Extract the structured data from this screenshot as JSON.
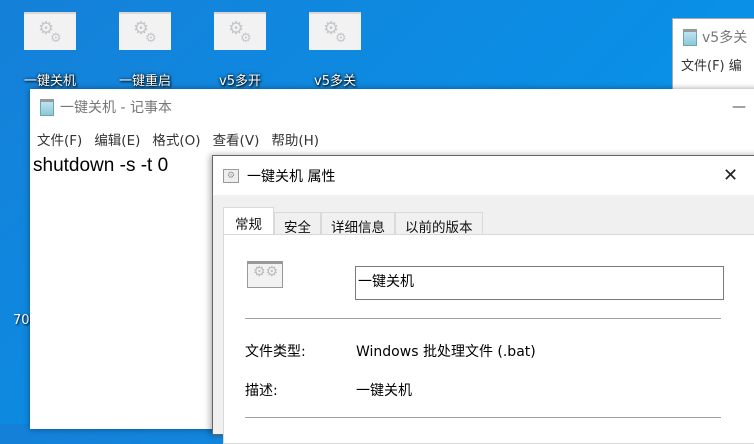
{
  "desktop": {
    "icons": [
      {
        "label": "一键关机"
      },
      {
        "label": "一键重启"
      },
      {
        "label": "v5多开"
      },
      {
        "label": "v5多关"
      }
    ],
    "partial_label": "70"
  },
  "notepad_back": {
    "title": "v5多关",
    "menu_first": "文件(F)",
    "menu_second": "编"
  },
  "notepad": {
    "title": "一键关机 - 记事本",
    "minimize": "—",
    "menu": [
      "文件(F)",
      "编辑(E)",
      "格式(O)",
      "查看(V)",
      "帮助(H)"
    ],
    "content": "shutdown -s -t 0"
  },
  "dialog": {
    "title": "一键关机 属性",
    "close": "✕",
    "tabs": [
      "常规",
      "安全",
      "详细信息",
      "以前的版本"
    ],
    "name_value": "一键关机",
    "rows": [
      {
        "label": "文件类型:",
        "value": "Windows 批处理文件 (.bat)"
      },
      {
        "label": "描述:",
        "value": "一键关机"
      }
    ]
  }
}
